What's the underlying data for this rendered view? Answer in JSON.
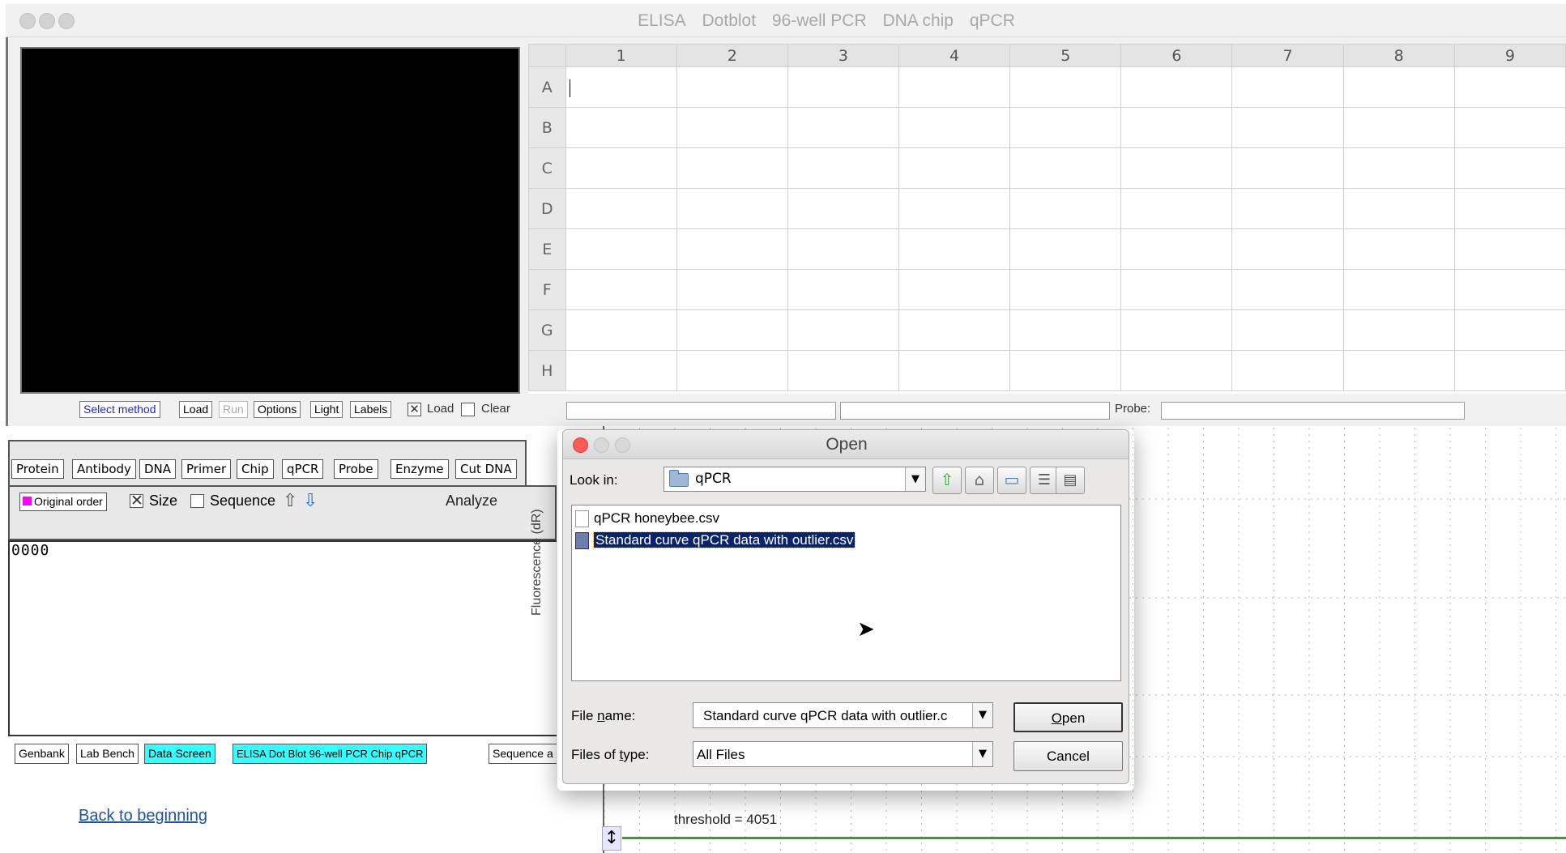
{
  "window": {
    "title_items": [
      "ELISA",
      "Dotblot",
      "96-well PCR",
      "DNA chip",
      "qPCR"
    ]
  },
  "plate": {
    "columns": [
      "1",
      "2",
      "3",
      "4",
      "5",
      "6",
      "7",
      "8",
      "9"
    ],
    "rows": [
      "A",
      "B",
      "C",
      "D",
      "E",
      "F",
      "G",
      "H"
    ]
  },
  "toolbar": {
    "select_method": "Select method",
    "load": "Load",
    "run": "Run",
    "options": "Options",
    "light": "Light",
    "labels": "Labels",
    "load_check_label": "Load",
    "load_checked": true,
    "clear_check_label": "Clear",
    "clear_checked": false,
    "probe_label": "Probe:"
  },
  "molecule_tabs": [
    "Protein",
    "Antibody",
    "DNA",
    "Primer",
    "Chip",
    "qPCR",
    "Probe",
    "Enzyme",
    "Cut DNA"
  ],
  "sort_bar": {
    "original_order": "Original order",
    "size_label": "Size",
    "size_checked": true,
    "sequence_label": "Sequence",
    "sequence_checked": false,
    "analyze": "Analyze"
  },
  "sequence_text": "0000",
  "bottom_tabs": {
    "genbank": "Genbank",
    "lab_bench": "Lab Bench",
    "data_screen": "Data Screen",
    "assays": "ELISA  Dot Blot  96-well PCR  Chip  qPCR",
    "sequence": "Sequence a"
  },
  "back_link": "Back to beginning",
  "plot": {
    "y_axis_label": "Fluorescence (dR)",
    "threshold_label": "threshold = 4051",
    "threshold_color": "#2ea12e"
  },
  "dialog": {
    "title": "Open",
    "look_in_label": "Look in:",
    "look_in_value": "qPCR",
    "files": [
      {
        "name": "qPCR honeybee.csv",
        "selected": false
      },
      {
        "name": "Standard curve qPCR data with outlier.csv",
        "selected": true
      }
    ],
    "file_name_label": "File name:",
    "file_name_value": "Standard curve qPCR data with outlier.c",
    "files_of_type_label": "Files of type:",
    "files_of_type_value": "All Files",
    "open_button": "Open",
    "cancel_button": "Cancel"
  },
  "colors": {
    "highlight_cyan": "#33ffff",
    "selection_blue": "#0a246a",
    "close_red": "#fc5b57",
    "link_blue": "#1a53a8"
  }
}
